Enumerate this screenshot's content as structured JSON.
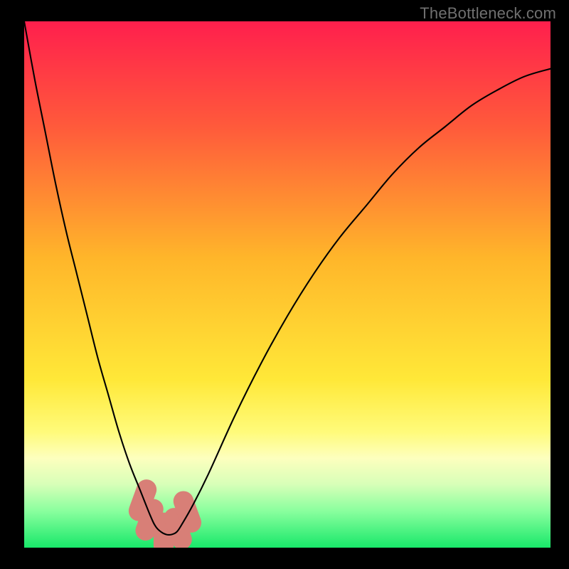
{
  "watermark": "TheBottleneck.com",
  "chart_data": {
    "type": "line",
    "title": "",
    "xlabel": "",
    "ylabel": "",
    "xlim": [
      0,
      100
    ],
    "ylim": [
      0,
      100
    ],
    "grid": false,
    "legend": false,
    "background_gradient": {
      "stops": [
        {
          "offset": 0.0,
          "color": "#ff1f4d"
        },
        {
          "offset": 0.2,
          "color": "#ff5a3b"
        },
        {
          "offset": 0.45,
          "color": "#ffb62a"
        },
        {
          "offset": 0.68,
          "color": "#ffe838"
        },
        {
          "offset": 0.78,
          "color": "#fffb7a"
        },
        {
          "offset": 0.83,
          "color": "#fdffbe"
        },
        {
          "offset": 0.88,
          "color": "#d7ffb8"
        },
        {
          "offset": 0.93,
          "color": "#8aff9e"
        },
        {
          "offset": 1.0,
          "color": "#18e86a"
        }
      ]
    },
    "curve": {
      "x": [
        0,
        2,
        4,
        6,
        8,
        10,
        12,
        14,
        16,
        18,
        20,
        22,
        24,
        25,
        26,
        27,
        28,
        29,
        30,
        32,
        35,
        40,
        45,
        50,
        55,
        60,
        65,
        70,
        75,
        80,
        85,
        90,
        95,
        100
      ],
      "y": [
        100,
        89,
        79,
        69,
        60,
        52,
        44,
        36,
        29,
        22,
        16,
        11,
        6,
        4,
        3,
        2.5,
        2.5,
        3,
        4.5,
        8,
        14,
        25,
        35,
        44,
        52,
        59,
        65,
        71,
        76,
        80,
        84,
        87,
        89.5,
        91
      ]
    },
    "highlight_region": {
      "type": "rounded_segments",
      "color": "#d87f77",
      "segments": [
        {
          "x": 22.5,
          "y": 9.0
        },
        {
          "x": 23.8,
          "y": 5.3
        },
        {
          "x": 26.5,
          "y": 2.6
        },
        {
          "x": 29.2,
          "y": 3.6
        },
        {
          "x": 31.0,
          "y": 6.8
        }
      ],
      "radius": 2.4
    },
    "note": "Values are estimated from pixel positions; axes were unlabeled in the source image so [0,100] normalized coordinates are used."
  }
}
